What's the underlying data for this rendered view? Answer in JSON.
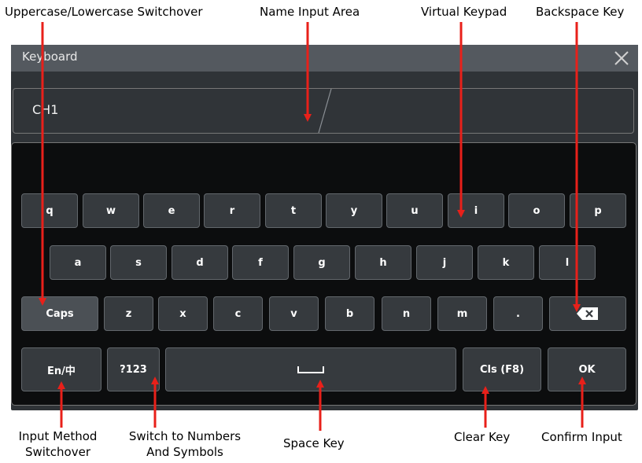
{
  "callouts": {
    "uppercase_lowercase": "Uppercase/Lowercase Switchover",
    "name_input_area": "Name Input Area",
    "virtual_keypad": "Virtual Keypad",
    "backspace_key": "Backspace Key",
    "input_method_1": "Input Method",
    "input_method_2": "Switchover",
    "numbers_symbols_1": "Switch to Numbers",
    "numbers_symbols_2": "And Symbols",
    "space_key": "Space Key",
    "clear_key": "Clear Key",
    "confirm_input": "Confirm Input"
  },
  "window": {
    "title": "Keyboard",
    "close_icon": "close-icon",
    "name_label": "CH1",
    "name_value": ""
  },
  "keys": {
    "row1": [
      "q",
      "w",
      "e",
      "r",
      "t",
      "y",
      "u",
      "i",
      "o",
      "p"
    ],
    "row2": [
      "a",
      "s",
      "d",
      "f",
      "g",
      "h",
      "j",
      "k",
      "l"
    ],
    "caps": "Caps",
    "row3": [
      "z",
      "x",
      "c",
      "v",
      "b",
      "n",
      "m",
      "."
    ],
    "backspace_icon": "backspace-icon",
    "lang": "En/中",
    "numbers": "?123",
    "space_icon": "space-icon",
    "clear": "Cls (F8)",
    "ok": "OK"
  },
  "colors": {
    "arrow": "#e8201a",
    "titlebar": "#54595f",
    "keypad_bg": "#0c0d0e",
    "key_bg": "#363a3e"
  }
}
